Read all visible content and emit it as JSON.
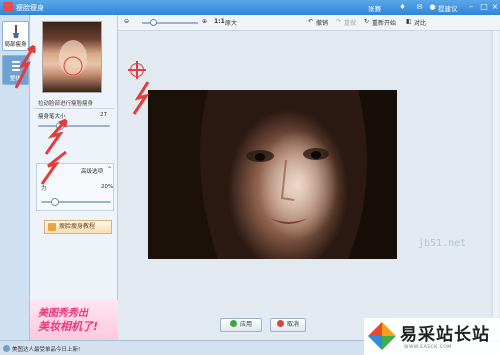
{
  "window": {
    "title": "瘦脸瘦身",
    "user": "张赛",
    "feedback": "提建议"
  },
  "tabs": [
    {
      "label": "局部瘦身",
      "icon": "brush-icon",
      "active": true
    },
    {
      "label": "整体",
      "icon": "body-slim-icon",
      "active": false
    }
  ],
  "panel": {
    "preview_hint": "拉动脸部进行瘦脸瘦身",
    "brush_size_label": "瘦身笔大小",
    "brush_size_value": "27",
    "brush_size_fraction": 0.3,
    "advanced_label": "高级选项",
    "strength_label": "力",
    "strength_value": "20%",
    "strength_fraction": 0.2,
    "tutorial_button": "瘦脸瘦身教程",
    "ad": {
      "line1": "美图秀秀出",
      "line2": "美妆相机了!"
    }
  },
  "toolbar": {
    "zoom_label": "原大",
    "ratio_label": "1:1",
    "undo": "撤销",
    "redo": "重做",
    "restart": "重新开始",
    "compare": "对比"
  },
  "actions": {
    "apply": "应用",
    "cancel": "取消"
  },
  "statusbar": {
    "text": "美图达人最受单品今日上新!"
  },
  "watermark": {
    "brand": "易采站长站",
    "url": "WWW.EASCK.COM",
    "faint": "jb51.net"
  },
  "colors": {
    "titlebar": "#2f86d6",
    "accent_red": "#e23c3c",
    "ad_pink": "#e83a7b"
  }
}
